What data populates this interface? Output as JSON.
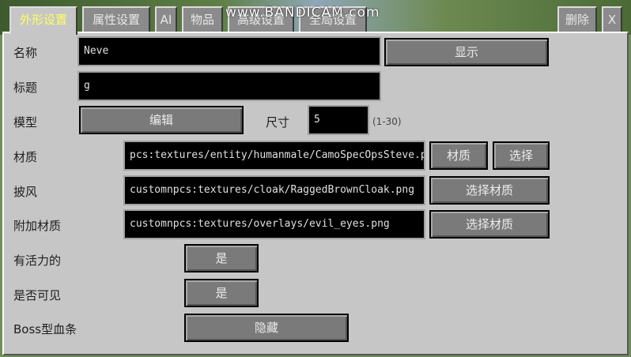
{
  "watermark": "www.BANDICAM.com",
  "tabs": [
    {
      "label": "外形设置",
      "active": true
    },
    {
      "label": "属性设置"
    },
    {
      "label": "AI"
    },
    {
      "label": "物品"
    },
    {
      "label": "高级设置"
    },
    {
      "label": "全局设置"
    }
  ],
  "top_buttons": {
    "delete": "删除",
    "close": "X"
  },
  "name": {
    "label": "名称",
    "value": "Neve",
    "button": "显示"
  },
  "title": {
    "label": "标题",
    "value": "g"
  },
  "model": {
    "label": "模型",
    "button": "编辑",
    "size_label": "尺寸",
    "size_value": "5",
    "size_hint": "(1-30)"
  },
  "texture": {
    "label": "材质",
    "value": "pcs:textures/entity/humanmale/CamoSpecOpsSteve.png",
    "button1": "材质",
    "button2": "选择"
  },
  "cape": {
    "label": "披风",
    "value": "customnpcs:textures/cloak/RaggedBrownCloak.png",
    "button": "选择材质"
  },
  "overlay": {
    "label": "附加材质",
    "value": "customnpcs:textures/overlays/evil_eyes.png",
    "button": "选择材质"
  },
  "alive": {
    "label": "有活力的",
    "button": "是"
  },
  "visible": {
    "label": "是否可见",
    "button": "是"
  },
  "bossbar": {
    "label": "Boss型血条",
    "button": "隐藏"
  }
}
